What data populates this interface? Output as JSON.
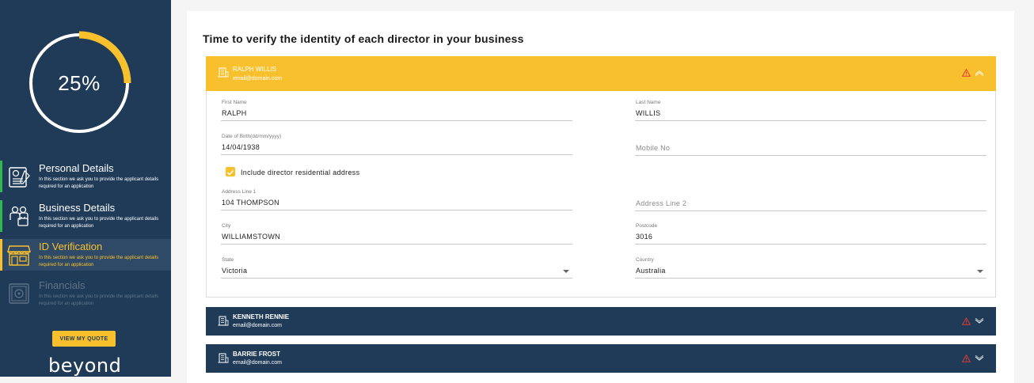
{
  "sidebar": {
    "progress": {
      "label": "25%",
      "fraction": 0.25,
      "ring_color": "#f9c02e"
    },
    "steps": [
      {
        "title": "Personal Details",
        "desc": "In this section we ask you to provide the applicant details required for an application",
        "icon": "id-card-icon",
        "state": "complete"
      },
      {
        "title": "Business Details",
        "desc": "In this section we ask you to provide the applicant details required for an application",
        "icon": "team-icon",
        "state": "complete"
      },
      {
        "title": "ID Verification",
        "desc": "In this section we ask you to provide the applicant details required for an application",
        "icon": "storefront-icon",
        "state": "active"
      },
      {
        "title": "Financials",
        "desc": "In this section we ask you to provide the applicant details required for an application",
        "icon": "safe-icon",
        "state": "disabled"
      }
    ],
    "quote_button": "VIEW MY QUOTE",
    "logo": "beyond"
  },
  "main": {
    "title": "Time to verify the identity of each director in your business",
    "directors": [
      {
        "name": "RALPH WILLIS",
        "email": "email@domain.com",
        "expanded": true,
        "form": {
          "first_name": {
            "label": "First Name",
            "value": "RALPH"
          },
          "last_name": {
            "label": "Last Name",
            "value": "WILLIS"
          },
          "dob": {
            "label": "Date of Birth(dd/mm/yyyy)",
            "value": "14/04/1938"
          },
          "mobile": {
            "placeholder": "Mobile No"
          },
          "include_address": {
            "label": "Include director residential address",
            "checked": true
          },
          "address1": {
            "label": "Address Line 1",
            "value": "104  THOMPSON"
          },
          "address2": {
            "placeholder": "Address Line 2"
          },
          "city": {
            "label": "City",
            "value": "WILLIAMSTOWN"
          },
          "postcode": {
            "label": "Postcode",
            "value": "3016"
          },
          "state": {
            "label": "State",
            "value": "Victoria"
          },
          "country": {
            "label": "Country",
            "value": "Australia"
          }
        }
      },
      {
        "name": "KENNETH RENNIE",
        "email": "email@domain.com",
        "expanded": false
      },
      {
        "name": "BARRIE FROST",
        "email": "email@domain.com",
        "expanded": false
      }
    ]
  },
  "colors": {
    "navy": "#1f3b58",
    "accent": "#f9c02e",
    "complete": "#2eb84a",
    "warning": "#e53935"
  }
}
